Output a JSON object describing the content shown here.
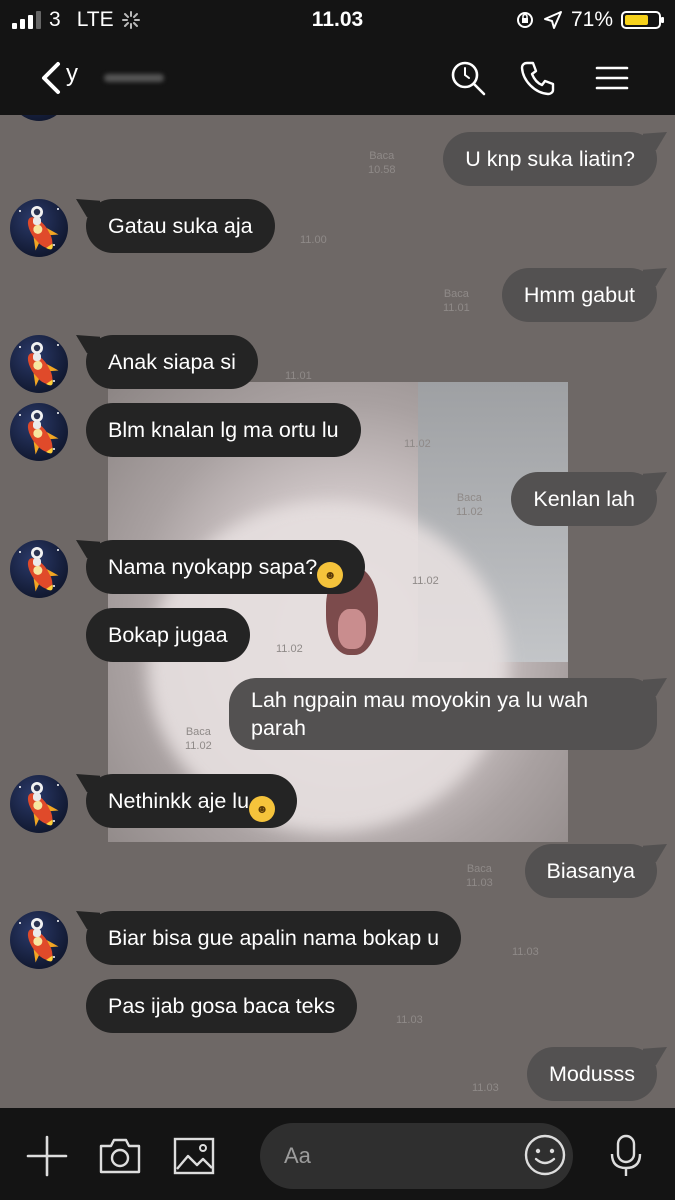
{
  "status_bar": {
    "carrier": "3",
    "network": "LTE",
    "time": "11.03",
    "battery": "71%",
    "battery_level": 0.71
  },
  "header": {
    "contact_initial": "y",
    "back_icon": "chevron-left-icon",
    "icons": [
      "search-icon",
      "phone-icon",
      "menu-icon"
    ]
  },
  "messages": [
    {
      "side": "out",
      "text": "U knp suka liatin?",
      "read": "Baca",
      "time": "10.58"
    },
    {
      "side": "in",
      "text": "Gatau suka aja",
      "time": "11.00"
    },
    {
      "side": "out",
      "text": "Hmm gabut",
      "read": "Baca",
      "time": "11.01"
    },
    {
      "side": "in",
      "text": "Anak siapa si",
      "time": "11.01"
    },
    {
      "side": "in",
      "text": "Blm knalan lg ma ortu lu",
      "time": "11.02"
    },
    {
      "side": "out",
      "text": "Kenlan lah",
      "read": "Baca",
      "time": "11.02"
    },
    {
      "side": "in",
      "text": "Nama nyokapp sapa?",
      "time": "11.02"
    },
    {
      "side": "in",
      "text": "Bokap jugaa",
      "time": "11.02"
    },
    {
      "side": "out",
      "text": "Lah ngpain mau moyokin ya lu wah parah",
      "read": "Baca",
      "time": "11.02"
    },
    {
      "side": "in",
      "text": "Nethinkk aje lu",
      "time": ""
    },
    {
      "side": "out",
      "text": "Biasanya",
      "read": "Baca",
      "time": "11.03"
    },
    {
      "side": "in",
      "text": "Biar bisa gue apalin nama bokap u",
      "time": "11.03"
    },
    {
      "side": "in",
      "text": "Pas ijab gosa baca teks",
      "time": "11.03"
    },
    {
      "side": "out",
      "text": "Modusss",
      "read": "",
      "time": "11.03"
    }
  ],
  "input": {
    "placeholder": "Aa"
  },
  "bottom_icons": [
    "plus-icon",
    "camera-icon",
    "image-icon",
    "emoji-icon",
    "microphone-icon"
  ],
  "colors": {
    "background": "#6e6866",
    "incoming_bubble": "#242424",
    "outgoing_bubble": "#535151",
    "bars": "#141414",
    "battery": "#f6d21c"
  }
}
